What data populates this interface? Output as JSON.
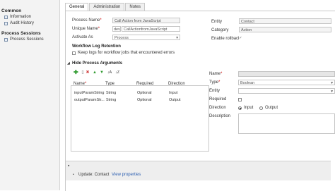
{
  "nav": {
    "common_heading": "Common",
    "items": [
      {
        "label": "Information"
      },
      {
        "label": "Audit History"
      }
    ],
    "sessions_heading": "Process Sessions",
    "session_items": [
      {
        "label": "Process Sessions"
      }
    ]
  },
  "tabs": [
    {
      "label": "General"
    },
    {
      "label": "Administration"
    },
    {
      "label": "Notes"
    }
  ],
  "general": {
    "process_name_label": "Process Name",
    "process_name_value": "Call Action from JavaScript",
    "unique_name_label": "Unique Name",
    "unique_name_prefix": "dev_",
    "unique_name_value": "CallActionfromJavaScript",
    "activate_as_label": "Activate As",
    "activate_as_value": "Process",
    "entity_label": "Entity",
    "entity_value": "Contact",
    "category_label": "Category",
    "category_value": "Action",
    "rollback_label": "Enable rollback",
    "rollback_checked": "✓"
  },
  "retention": {
    "heading": "Workflow Log Retention",
    "keep_logs_label": "Keep logs for workflow jobs that encountered errors"
  },
  "arguments": {
    "heading": "Hide Process Arguments",
    "toolbar_icons": [
      "add-icon",
      "delete-icon",
      "move-up-icon",
      "move-down-icon",
      "sort-ascending-icon",
      "sort-descending-icon"
    ],
    "toolbar_glyphs": {
      "sort_asc": "↓A",
      "sort_desc": "↓Z"
    },
    "columns": [
      "Name",
      "Type",
      "Required",
      "Direction"
    ],
    "rows": [
      {
        "name": "inputParamString",
        "type": "String",
        "required": "Optional",
        "direction": "Input"
      },
      {
        "name": "outputParamStr...",
        "type": "String",
        "required": "Optional",
        "direction": "Output"
      }
    ]
  },
  "details": {
    "name_label": "Name",
    "type_label": "Type",
    "type_value": "Boolean",
    "entity_label": "Entity",
    "required_label": "Required",
    "direction_label": "Direction",
    "direction_input": "Input",
    "direction_output": "Output",
    "description_label": "Description"
  },
  "footer": {
    "update_label": "Update:",
    "update_entity": "Contact",
    "view_properties": "View properties"
  },
  "colors": {
    "required_star": "#cc0000",
    "link": "#2a5db0",
    "selected_nav": "#d9e4f1"
  }
}
